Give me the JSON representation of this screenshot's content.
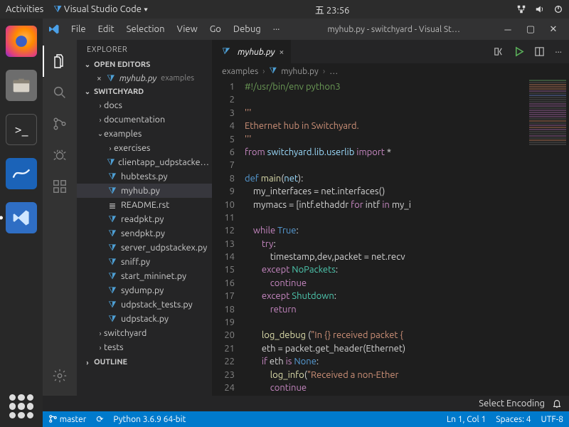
{
  "gnome": {
    "activities": "Activities",
    "app_menu": "Visual Studio Code ▾",
    "clock": "五 23:56"
  },
  "vscode": {
    "menu": [
      "File",
      "Edit",
      "Selection",
      "View",
      "Go",
      "Debug"
    ],
    "menu_overflow": "···",
    "title": "myhub.py - switchyard - Visual St…",
    "explorer_label": "EXPLORER",
    "open_editors_label": "OPEN EDITORS",
    "workspace_label": "SWITCHYARD",
    "outline_label": "OUTLINE",
    "open_editor": {
      "name": "myhub.py",
      "hint": "examples"
    },
    "tree": {
      "docs": "docs",
      "documentation": "documentation",
      "examples": "examples",
      "exercises": "exercises",
      "files": [
        "clientapp_udpstacke…",
        "hubtests.py",
        "myhub.py",
        "README.rst",
        "readpkt.py",
        "sendpkt.py",
        "server_udpstackex.py",
        "sniff.py",
        "start_mininet.py",
        "sydump.py",
        "udpstack_tests.py",
        "udpstack.py"
      ],
      "switchyard": "switchyard",
      "tests": "tests"
    },
    "tab_name": "myhub.py",
    "breadcrumb": [
      "examples",
      "myhub.py",
      "…"
    ],
    "code": {
      "lines": [
        [
          {
            "t": "#!/usr/bin/env python3",
            "c": "cmt"
          }
        ],
        [],
        [
          {
            "t": "'''",
            "c": "str"
          }
        ],
        [
          {
            "t": "Ethernet hub in Switchyard.",
            "c": "str"
          }
        ],
        [
          {
            "t": "'''",
            "c": "str"
          }
        ],
        [
          {
            "t": "from",
            "c": "kw"
          },
          {
            "t": " switchyard.lib.userlib ",
            "c": "var"
          },
          {
            "t": "import",
            "c": "kw"
          },
          {
            "t": " *",
            "c": ""
          }
        ],
        [],
        [
          {
            "t": "def ",
            "c": "kw2"
          },
          {
            "t": "main",
            "c": "fn"
          },
          {
            "t": "(",
            "c": ""
          },
          {
            "t": "net",
            "c": "var"
          },
          {
            "t": "):",
            "c": ""
          }
        ],
        [
          {
            "t": "    my_interfaces = net.interfaces()"
          }
        ],
        [
          {
            "t": "    mymacs = [intf.ethaddr "
          },
          {
            "t": "for",
            "c": "kw"
          },
          {
            "t": " intf "
          },
          {
            "t": "in",
            "c": "kw"
          },
          {
            "t": " my_i"
          }
        ],
        [],
        [
          {
            "t": "    "
          },
          {
            "t": "while ",
            "c": "kw"
          },
          {
            "t": "True",
            "c": "cst"
          },
          {
            "t": ":"
          }
        ],
        [
          {
            "t": "        "
          },
          {
            "t": "try",
            "c": "kw"
          },
          {
            "t": ":"
          }
        ],
        [
          {
            "t": "            timestamp,dev,packet = net.recv"
          }
        ],
        [
          {
            "t": "        "
          },
          {
            "t": "except ",
            "c": "kw"
          },
          {
            "t": "NoPackets",
            "c": "cls"
          },
          {
            "t": ":"
          }
        ],
        [
          {
            "t": "            "
          },
          {
            "t": "continue",
            "c": "kw"
          }
        ],
        [
          {
            "t": "        "
          },
          {
            "t": "except ",
            "c": "kw"
          },
          {
            "t": "Shutdown",
            "c": "cls"
          },
          {
            "t": ":"
          }
        ],
        [
          {
            "t": "            "
          },
          {
            "t": "return",
            "c": "kw"
          }
        ],
        [],
        [
          {
            "t": "        "
          },
          {
            "t": "log_debug ",
            "c": "fn"
          },
          {
            "t": "("
          },
          {
            "t": "\"In {} received packet {",
            "c": "str"
          }
        ],
        [
          {
            "t": "        eth = packet.get_header(Ethernet)"
          }
        ],
        [
          {
            "t": "        "
          },
          {
            "t": "if ",
            "c": "kw"
          },
          {
            "t": "eth "
          },
          {
            "t": "is ",
            "c": "kw"
          },
          {
            "t": "None",
            "c": "cst"
          },
          {
            "t": ":"
          }
        ],
        [
          {
            "t": "            "
          },
          {
            "t": "log_info",
            "c": "fn"
          },
          {
            "t": "("
          },
          {
            "t": "\"Received a non-Ether",
            "c": "str"
          }
        ],
        [
          {
            "t": "            "
          },
          {
            "t": "continue",
            "c": "kw"
          }
        ],
        []
      ]
    },
    "status": {
      "branch": "master",
      "sync_icon": "⟳",
      "python": "Python 3.6.9 64-bit",
      "ln_col": "Ln 1, Col 1",
      "spaces": "Spaces: 4",
      "encoding": "UTF-8",
      "picker": "Select Encoding"
    }
  }
}
